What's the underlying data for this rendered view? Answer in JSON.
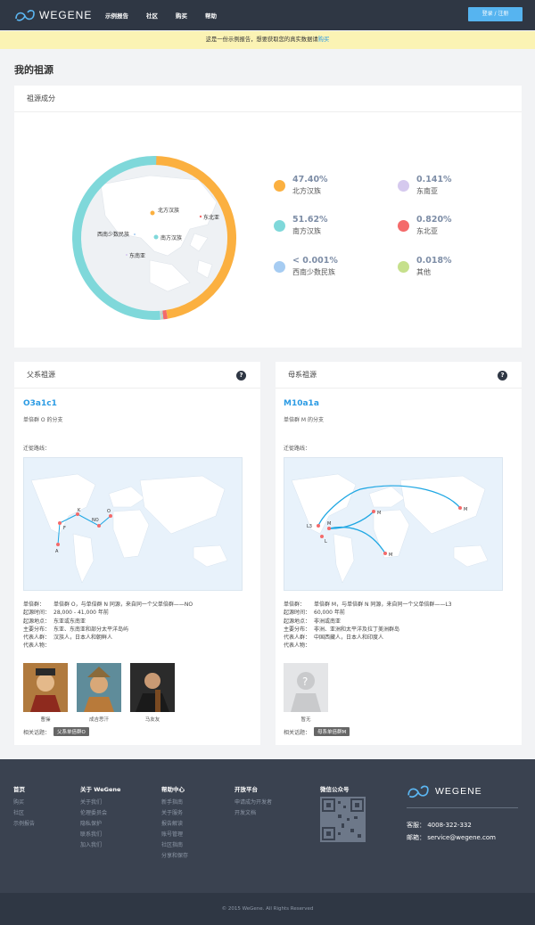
{
  "nav": {
    "brand": "WEGENE",
    "links": [
      "示例报告",
      "社区",
      "购买",
      "帮助"
    ],
    "login": "登录 / 注册"
  },
  "notice": {
    "text": "这是一份示例报告，想要获取您的真实数据请",
    "link": "购买"
  },
  "page_title": "我的祖源",
  "ancestry": {
    "header": "祖源成分",
    "map_labels": [
      "北方汉族",
      "东北亚",
      "西南少数民族",
      "南方汉族",
      "东南亚"
    ],
    "legend": [
      {
        "pct": "47.40%",
        "name": "北方汉族",
        "color": "#fbb040"
      },
      {
        "pct": "0.141%",
        "name": "东南亚",
        "color": "#d5c9ee"
      },
      {
        "pct": "51.62%",
        "name": "南方汉族",
        "color": "#7fd8da"
      },
      {
        "pct": "0.820%",
        "name": "东北亚",
        "color": "#f46a6a"
      },
      {
        "pct": "< 0.001%",
        "name": "西南少数民族",
        "color": "#a6ccf2"
      },
      {
        "pct": "0.018%",
        "name": "其他",
        "color": "#c6e08c"
      }
    ],
    "chart_data": {
      "type": "pie",
      "categories": [
        "北方汉族",
        "东南亚",
        "南方汉族",
        "东北亚",
        "西南少数民族",
        "其他"
      ],
      "values": [
        47.4,
        0.141,
        51.62,
        0.82,
        0.001,
        0.018
      ]
    }
  },
  "paternal": {
    "header": "父系祖源",
    "code": "O3a1c1",
    "desc": "单倍群 O 的分支",
    "route_label": "迁徙路线：",
    "route_points": [
      "A",
      "F",
      "K",
      "NO",
      "O"
    ],
    "info": [
      [
        "单倍群：",
        "单倍群 O，与单倍群 N 同源，来自同一个父单倍群——NO"
      ],
      [
        "起源时间：",
        "28,000 - 41,000 年前"
      ],
      [
        "起源地点：",
        "东亚或东南亚"
      ],
      [
        "主要分布：",
        "东亚、东南亚和部分太平洋岛屿"
      ],
      [
        "代表人群：",
        "汉族人，日本人和朝鲜人"
      ],
      [
        "代表人物：",
        ""
      ]
    ],
    "people": [
      "曹操",
      "成吉思汗",
      "马友友"
    ],
    "topic_label": "相关话题：",
    "topic_tag": "父系单倍群O"
  },
  "maternal": {
    "header": "母系祖源",
    "code": "M10a1a",
    "desc": "单倍群 M 的分支",
    "route_label": "迁徙路线：",
    "route_points": [
      "L3",
      "M",
      "L",
      "M",
      "M",
      "M"
    ],
    "info": [
      [
        "单倍群：",
        "单倍群 M，与单倍群 N 同源，来自同一个父单倍群——L3"
      ],
      [
        "起源时间：",
        "60,000 年前"
      ],
      [
        "起源地点：",
        "非洲或南亚"
      ],
      [
        "主要分布：",
        "非洲、亚洲和太平洋及拉丁美洲群岛"
      ],
      [
        "代表人群：",
        "中国西藏人，日本人和印度人"
      ],
      [
        "代表人物：",
        ""
      ]
    ],
    "people": [
      "暂无"
    ],
    "topic_label": "相关话题：",
    "topic_tag": "母系单倍群M"
  },
  "footer": {
    "cols": [
      {
        "title": "首页",
        "items": [
          "购买",
          "社区",
          "示例报告"
        ]
      },
      {
        "title": "关于 WeGene",
        "items": [
          "关于我们",
          "伦理委员会",
          "隐私保护",
          "联系我们",
          "加入我们"
        ]
      },
      {
        "title": "帮助中心",
        "items": [
          "新手指南",
          "关于服务",
          "报告解读",
          "账号管理",
          "社区指南",
          "分享和保存"
        ]
      },
      {
        "title": "开放平台",
        "items": [
          "申请成为开发者",
          "开发文档"
        ]
      },
      {
        "title": "微信公众号",
        "items": []
      }
    ],
    "brand": "WEGENE",
    "phone": "客服：  4008-322-332",
    "email": "邮箱：  service@wegene.com",
    "copyright": "© 2015 WeGene. All Rights Reserved"
  }
}
